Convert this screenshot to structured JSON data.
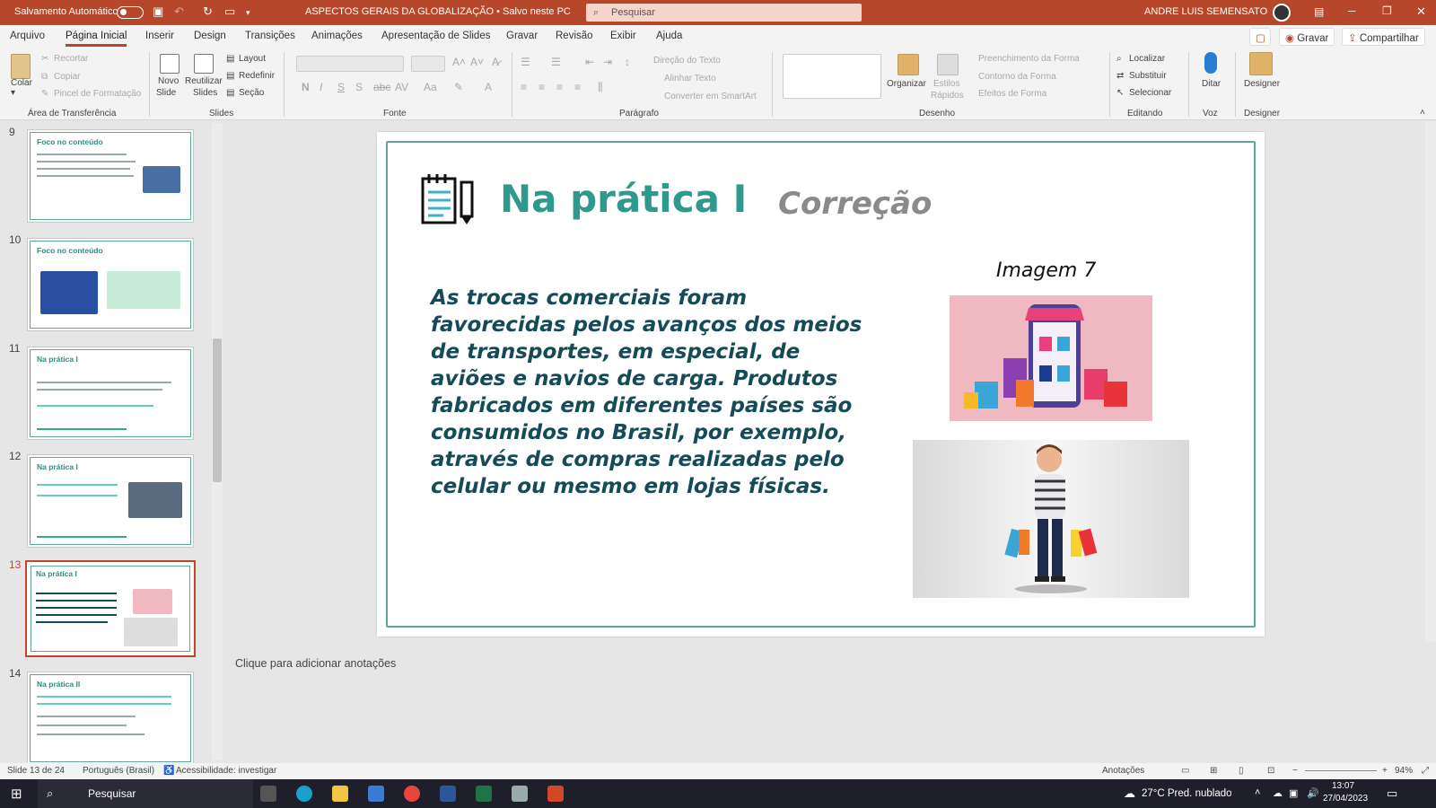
{
  "titlebar": {
    "autosave_label": "Salvamento Automático",
    "doc_title": "ASPECTOS GERAIS DA GLOBALIZAÇÃO • Salvo neste PC",
    "search_placeholder": "Pesquisar",
    "user_name": "ANDRE LUIS SEMENSATO"
  },
  "menu": {
    "tabs": [
      "Arquivo",
      "Página Inicial",
      "Inserir",
      "Design",
      "Transições",
      "Animações",
      "Apresentação de Slides",
      "Gravar",
      "Revisão",
      "Exibir",
      "Ajuda"
    ],
    "active_tab": "Página Inicial",
    "record_button": "Gravar",
    "share_button": "Compartilhar"
  },
  "ribbon": {
    "paste": "Colar",
    "cut": "Recortar",
    "copy": "Copiar",
    "format_painter": "Pincel de Formatação",
    "new_slide_1": "Novo",
    "new_slide_2": "Slide",
    "reuse_1": "Reutilizar",
    "reuse_2": "Slides",
    "layout": "Layout",
    "reset": "Redefinir",
    "section": "Seção",
    "text_direction": "Direção do Texto",
    "align_text": "Alinhar Texto",
    "smartart": "Converter em SmartArt",
    "arrange": "Organizar",
    "quick_styles_1": "Estilos",
    "quick_styles_2": "Rápidos",
    "shape_fill": "Preenchimento da Forma",
    "shape_outline": "Contorno da Forma",
    "shape_effects": "Efeitos de Forma",
    "find": "Localizar",
    "replace": "Substituir",
    "select": "Selecionar",
    "dictate": "Ditar",
    "designer": "Designer",
    "groups": {
      "clipboard": "Área de Transferência",
      "slides": "Slides",
      "font": "Fonte",
      "paragraph": "Parágrafo",
      "drawing": "Desenho",
      "editing": "Editando",
      "voice": "Voz",
      "designer": "Designer"
    }
  },
  "thumbnails": [
    {
      "num": "9",
      "title": "Foco no conteúdo"
    },
    {
      "num": "10",
      "title": "Foco no conteúdo"
    },
    {
      "num": "11",
      "title": "Na prática I"
    },
    {
      "num": "12",
      "title": "Na prática I"
    },
    {
      "num": "13",
      "title": "Na prática I"
    },
    {
      "num": "14",
      "title": "Na prática II"
    }
  ],
  "slide": {
    "title": "Na prática I",
    "subtitle": "Correção",
    "body": "As trocas comerciais foram favorecidas pelos avanços dos meios de transportes, em especial, de aviões e navios de carga. Produtos fabricados em diferentes países são consumidos no Brasil, por exemplo, através de compras realizadas pelo celular ou mesmo em lojas físicas.",
    "image_label": "Imagem 7"
  },
  "notes_placeholder": "Clique para adicionar anotações",
  "status": {
    "slide_info": "Slide 13 de 24",
    "language": "Português (Brasil)",
    "accessibility": "Acessibilidade: investigar",
    "notes": "Anotações",
    "zoom": "94%"
  },
  "taskbar": {
    "search": "Pesquisar",
    "weather": "27°C  Pred. nublado",
    "time": "13:07",
    "date": "27/04/2023"
  },
  "colors": {
    "accent": "#b7472a",
    "title_teal": "#2e9a8e",
    "body_text": "#154a57"
  }
}
